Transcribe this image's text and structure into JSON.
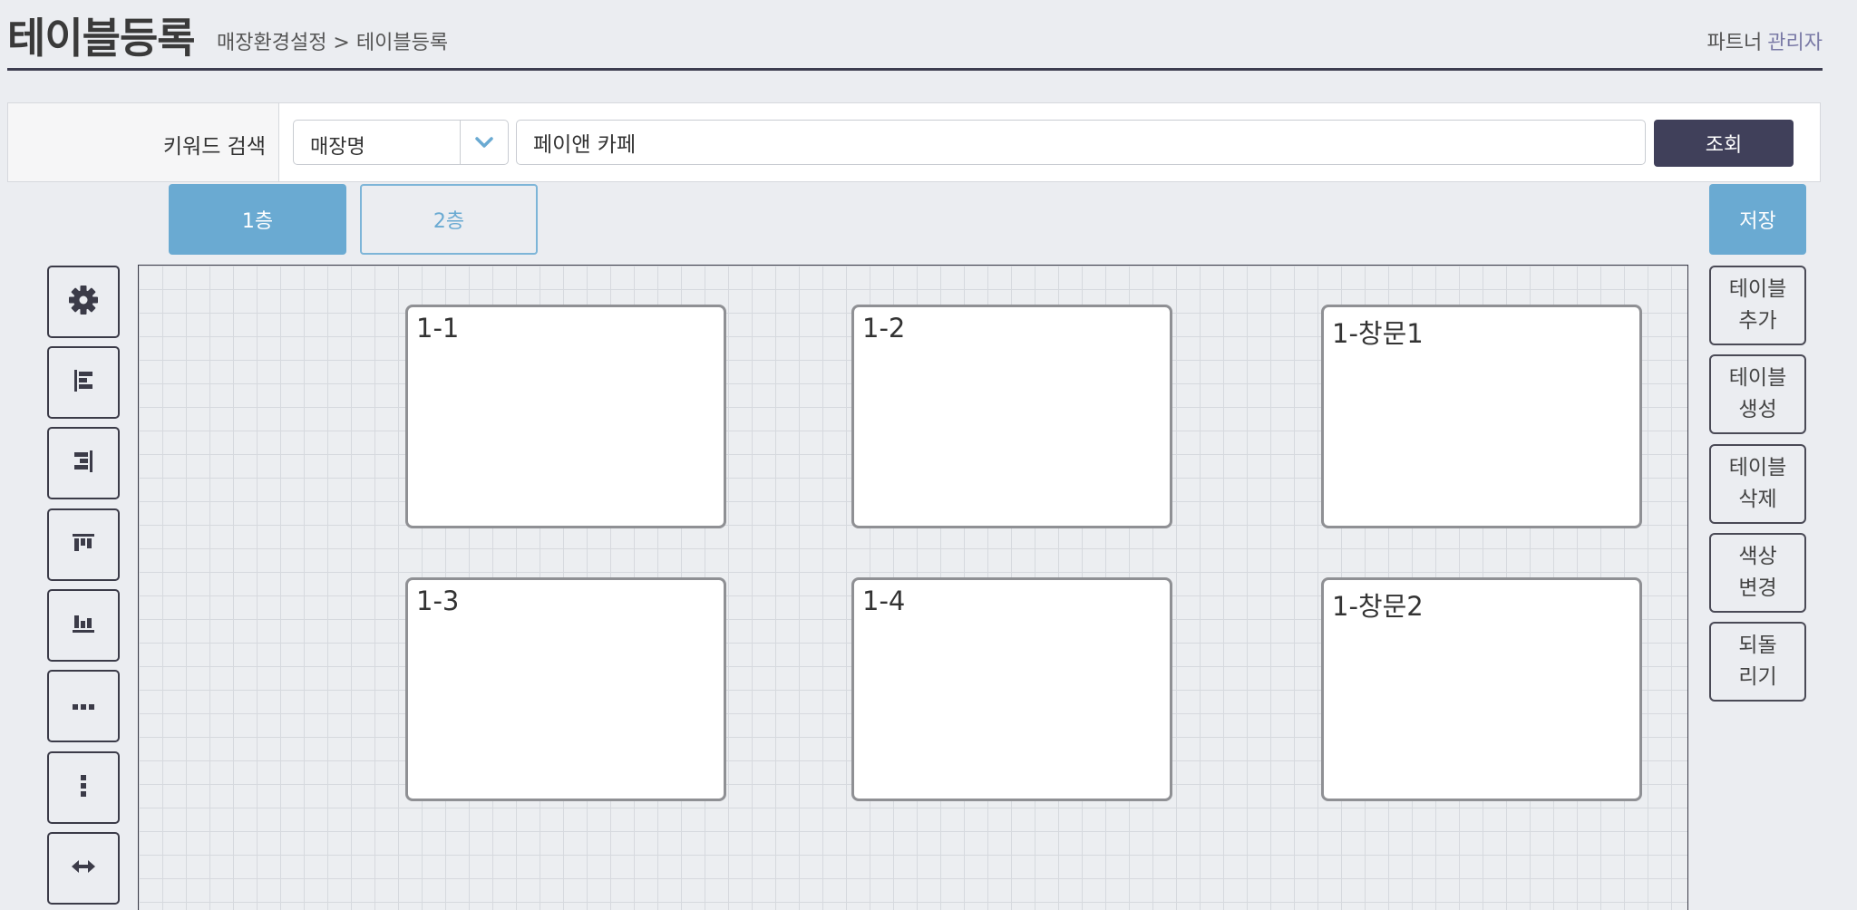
{
  "header": {
    "title": "테이블등록",
    "breadcrumb": "매장환경설정 > 테이블등록",
    "partner_label": "파트너",
    "admin_label": "관리자"
  },
  "search": {
    "label": "키워드 검색",
    "select_value": "매장명",
    "input_value": "페이앤 카페",
    "button_label": "조회"
  },
  "floors": {
    "tabs": [
      {
        "label": "1층",
        "active": true
      },
      {
        "label": "2층",
        "active": false
      }
    ]
  },
  "toolbar": {
    "save_label": "저장",
    "tools": [
      {
        "icon": "gear-icon"
      },
      {
        "icon": "align-left-icon"
      },
      {
        "icon": "align-right-icon"
      },
      {
        "icon": "align-top-icon"
      },
      {
        "icon": "align-bottom-icon"
      },
      {
        "icon": "distribute-horizontal-icon"
      },
      {
        "icon": "distribute-vertical-icon"
      },
      {
        "icon": "resize-horizontal-icon"
      }
    ]
  },
  "actions": [
    {
      "line1": "테이블",
      "line2": "추가"
    },
    {
      "line1": "테이블",
      "line2": "생성"
    },
    {
      "line1": "테이블",
      "line2": "삭제"
    },
    {
      "line1": "색상",
      "line2": "변경"
    },
    {
      "line1": "되돌",
      "line2": "리기"
    }
  ],
  "tables": [
    {
      "label": "1-1"
    },
    {
      "label": "1-2"
    },
    {
      "label": "1-창문1"
    },
    {
      "label": "1-3"
    },
    {
      "label": "1-4"
    },
    {
      "label": "1-창문2"
    }
  ],
  "colors": {
    "accent": "#6aaad2",
    "dark": "#40405a",
    "background": "#ebedf1"
  }
}
